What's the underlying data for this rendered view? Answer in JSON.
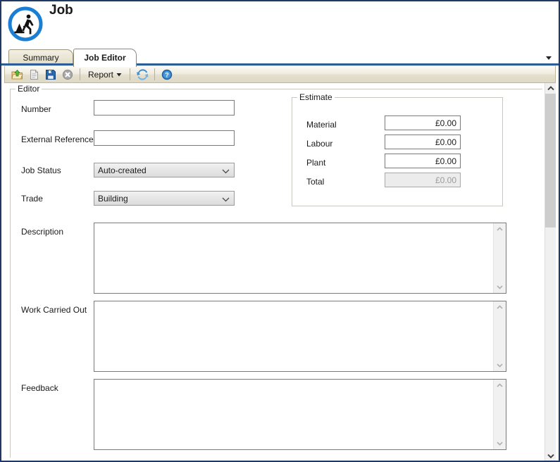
{
  "window": {
    "title": "Job",
    "app_icon": "roadworks-icon",
    "border_color": "#1f3864",
    "accent_color": "#2e5c97",
    "icon_blue": "#1a7fd4"
  },
  "tabs": {
    "items": [
      {
        "label": "Summary",
        "active": false
      },
      {
        "label": "Job Editor",
        "active": true
      }
    ],
    "overflow_icon": "chevron-down-icon"
  },
  "toolbar": {
    "buttons": [
      {
        "name": "open-export",
        "icon": "folder-up-arrow-icon",
        "label": ""
      },
      {
        "name": "new",
        "icon": "new-document-icon",
        "label": ""
      },
      {
        "name": "save",
        "icon": "floppy-disk-icon",
        "label": ""
      },
      {
        "name": "cancel",
        "icon": "cancel-circle-icon",
        "label": ""
      }
    ],
    "report_label": "Report",
    "report_caret": "▾",
    "refresh_icon": "refresh-icon",
    "help_icon": "help-icon"
  },
  "editor": {
    "group_label": "Editor",
    "fields": {
      "number": {
        "label": "Number",
        "value": "",
        "placeholder": ""
      },
      "external_reference": {
        "label": "External Reference",
        "value": "",
        "placeholder": ""
      },
      "job_status": {
        "label": "Job Status",
        "value": "Auto-created"
      },
      "trade": {
        "label": "Trade",
        "value": "Building"
      },
      "description": {
        "label": "Description",
        "value": "",
        "placeholder": ""
      },
      "work_carried_out": {
        "label": "Work Carried Out",
        "value": "",
        "placeholder": ""
      },
      "feedback": {
        "label": "Feedback",
        "value": "",
        "placeholder": ""
      }
    }
  },
  "estimate": {
    "group_label": "Estimate",
    "rows": [
      {
        "label": "Material",
        "value": "£0.00",
        "readonly": false
      },
      {
        "label": "Labour",
        "value": "£0.00",
        "readonly": false
      },
      {
        "label": "Plant",
        "value": "£0.00",
        "readonly": false
      },
      {
        "label": "Total",
        "value": "£0.00",
        "readonly": true
      }
    ]
  },
  "scrollbar": {
    "up_icon": "chevron-up-icon",
    "down_icon": "chevron-down-icon"
  }
}
